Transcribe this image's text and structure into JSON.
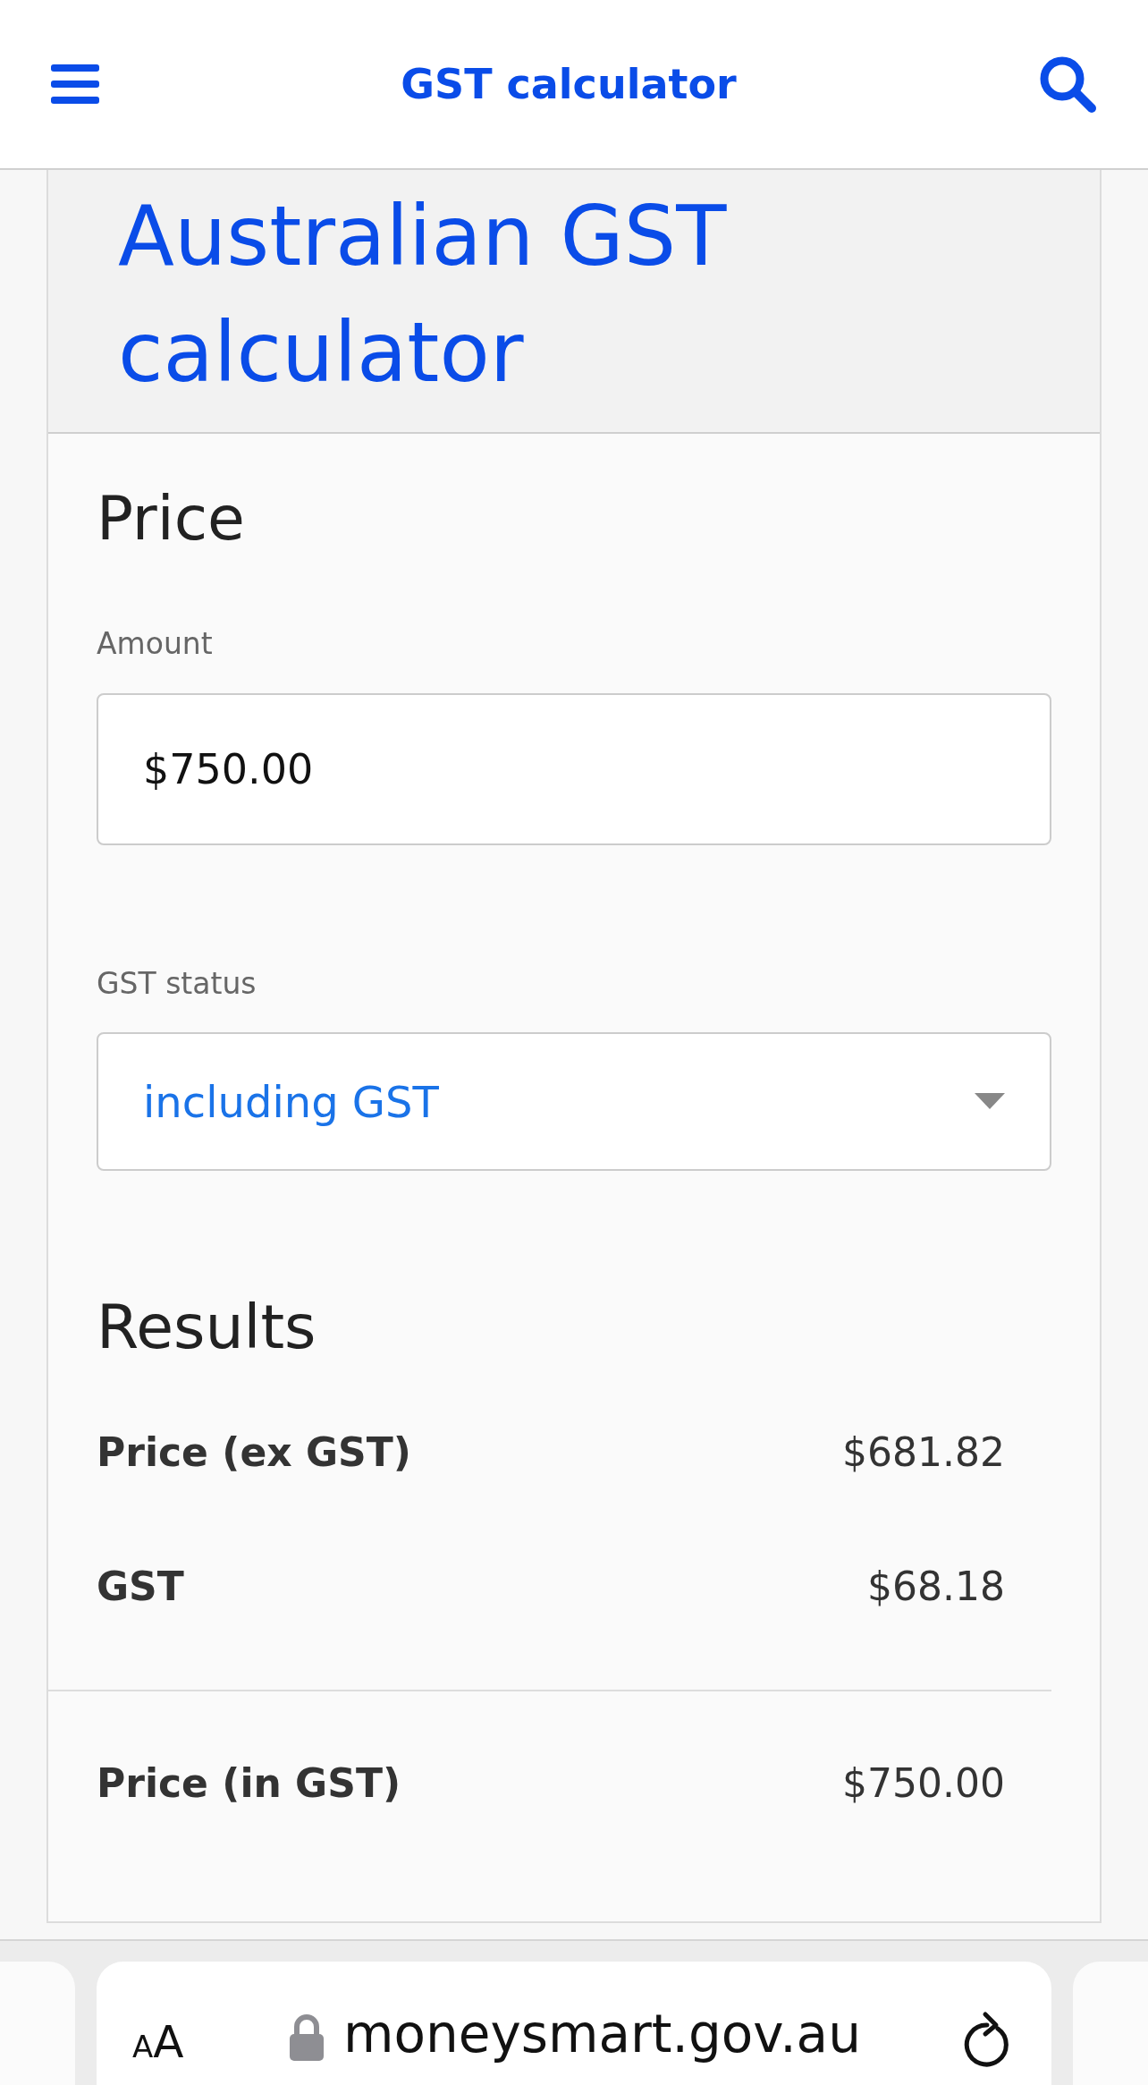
{
  "header": {
    "title": "GST calculator"
  },
  "hero": {
    "heading": "Australian GST calculator"
  },
  "price": {
    "heading": "Price",
    "amount": {
      "label": "Amount",
      "value": "$750.00"
    },
    "gst_status": {
      "label": "GST status",
      "value": "including GST"
    }
  },
  "results": {
    "heading": "Results",
    "rows": [
      {
        "label": "Price (ex GST)",
        "value": "$681.82",
        "total": false
      },
      {
        "label": "GST",
        "value": "$68.18",
        "total": false
      },
      {
        "label": "Price (in GST)",
        "value": "$750.00",
        "total": true
      }
    ]
  },
  "browser_bar": {
    "text_size": "AA",
    "url": "moneysmart.gov.au"
  }
}
